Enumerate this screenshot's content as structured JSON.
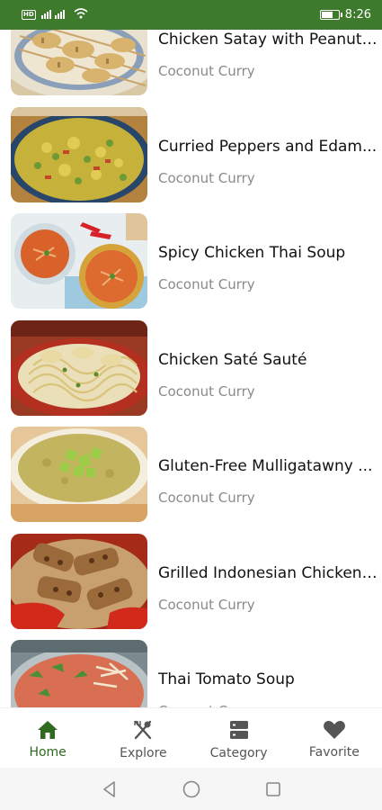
{
  "status_bar": {
    "network_badge": "HD",
    "time": "8:26"
  },
  "recipes": [
    {
      "title": "Chicken Satay with Peanut ...",
      "subtitle": "Coconut Curry",
      "image": "satay-photo"
    },
    {
      "title": "Curried Peppers and Edam...",
      "subtitle": "Coconut Curry",
      "image": "curried-peppers-photo"
    },
    {
      "title": "Spicy Chicken Thai Soup",
      "subtitle": "Coconut Curry",
      "image": "thai-soup-photo"
    },
    {
      "title": "Chicken Saté Sauté",
      "subtitle": "Coconut Curry",
      "image": "sate-saute-photo"
    },
    {
      "title": "Gluten-Free Mulligatawny ...",
      "subtitle": "Coconut Curry",
      "image": "mulligatawny-photo"
    },
    {
      "title": "Grilled Indonesian Chicken ...",
      "subtitle": "Coconut Curry",
      "image": "indonesian-chicken-photo"
    },
    {
      "title": "Thai Tomato Soup",
      "subtitle": "Coconut Curry",
      "image": "tomato-soup-photo"
    }
  ],
  "bottom_nav": {
    "items": [
      {
        "label": "Home",
        "icon": "home-icon",
        "active": true
      },
      {
        "label": "Explore",
        "icon": "utensils-icon",
        "active": false
      },
      {
        "label": "Category",
        "icon": "category-icon",
        "active": false
      },
      {
        "label": "Favorite",
        "icon": "heart-icon",
        "active": false
      }
    ]
  },
  "system_nav": {
    "items": [
      "back-icon",
      "home-circle-icon",
      "recents-icon"
    ]
  },
  "colors": {
    "status_bar": "#3d7a2c",
    "active_nav": "#2e6a1f",
    "inactive_nav": "#555555",
    "subtitle": "#8a8a8a"
  }
}
